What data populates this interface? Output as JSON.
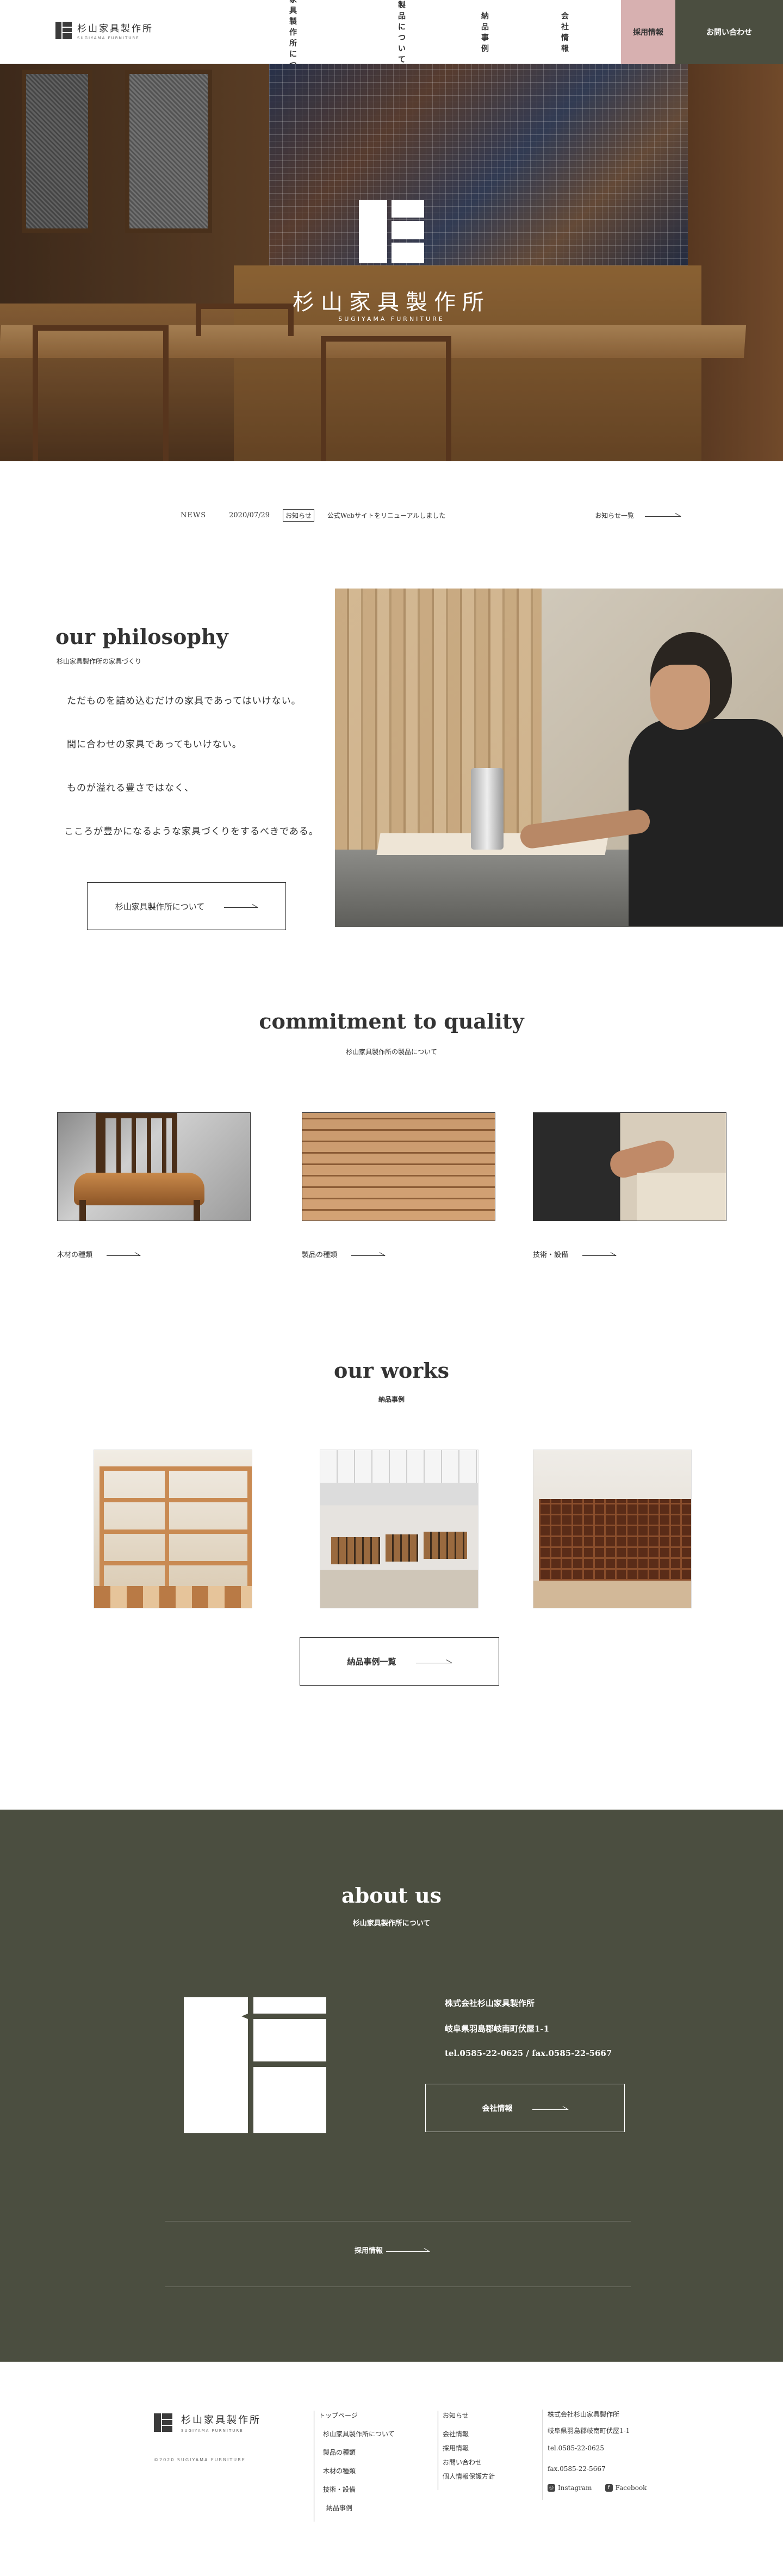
{
  "header": {
    "logo_jp": "杉山家具製作所",
    "logo_en": "SUGIYAMA FURNITURE",
    "nav": [
      "杉山家具製作所について",
      "製品について",
      "納品事例",
      "会社情報"
    ],
    "recruit": "採用情報",
    "contact": "お問い合わせ"
  },
  "hero": {
    "title": "杉山家具製作所",
    "subtitle": "SUGIYAMA FURNITURE"
  },
  "news": {
    "label": "NEWS",
    "date": "2020/07/29",
    "category": "お知らせ",
    "title": "公式Webサイトをリニューアルしました",
    "all_link": "お知らせ一覧"
  },
  "philosophy": {
    "title": "our philosophy",
    "subtitle": "杉山家具製作所の家具づくり",
    "lines": [
      "ただものを詰め込むだけの家具であってはいけない。",
      "間に合わせの家具であってもいけない。",
      "ものが溢れる豊さではなく、",
      "こころが豊かになるような家具づくりをするべきである。"
    ],
    "button": "杉山家具製作所について"
  },
  "commitment": {
    "title": "commitment to quality",
    "subtitle": "杉山家具製作所の製品について",
    "items": [
      "木材の種類",
      "製品の種類",
      "技術・設備"
    ]
  },
  "works": {
    "title": "our works",
    "subtitle": "納品事例",
    "button": "納品事例一覧"
  },
  "about": {
    "title": "about us",
    "subtitle": "杉山家具製作所について",
    "company": "株式会社杉山家具製作所",
    "address": "岐阜県羽島郡岐南町伏屋1-1",
    "tel": "tel.0585-22-0625 / fax.0585-22-5667",
    "button": "会社情報",
    "recruit": "採用情報"
  },
  "footer": {
    "logo_jp": "杉山家具製作所",
    "logo_en": "SUGIYAMA FURNITURE",
    "copyright": "©2020 SUGIYAMA FURNITURE",
    "col1": [
      "トップページ",
      "杉山家具製作所について",
      "製品の種類",
      "木材の種類",
      "技術・設備",
      "納品事例"
    ],
    "col2": [
      "お知らせ",
      "会社情報",
      "採用情報",
      "お問い合わせ",
      "個人情報保護方針"
    ],
    "company": "株式会社杉山家具製作所",
    "address": "岐阜県羽島郡岐南町伏屋1-1",
    "tel": "tel.0585-22-0625",
    "fax": "fax.0585-22-5667",
    "social": [
      "Instagram",
      "Facebook"
    ]
  },
  "colors": {
    "accent_dark": "#4b4e40",
    "accent_pink": "#d7b0b0"
  }
}
